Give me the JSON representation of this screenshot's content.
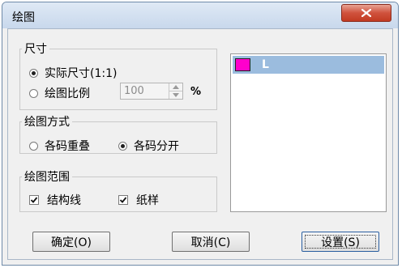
{
  "window": {
    "title": "绘图",
    "close_glyph": "x"
  },
  "size_group": {
    "legend": "尺寸",
    "actual_size_label": "实际尺寸(1:1)",
    "actual_size_selected": true,
    "scale_label": "绘图比例",
    "scale_selected": false,
    "scale_value": "100",
    "scale_unit": "%"
  },
  "method_group": {
    "legend": "绘图方式",
    "overlap_label": "各码重叠",
    "overlap_selected": false,
    "separate_label": "各码分开",
    "separate_selected": true
  },
  "range_group": {
    "legend": "绘图范围",
    "structure_label": "结构线",
    "structure_checked": true,
    "pattern_label": "纸样",
    "pattern_checked": true
  },
  "size_list": {
    "items": [
      {
        "label": "L",
        "color": "#ff00cc",
        "selected": true
      }
    ],
    "selection_color": "#9bbcde"
  },
  "buttons": {
    "ok_label": "确定(O)",
    "cancel_label": "取消(C)",
    "settings_label": "设置(S)"
  }
}
